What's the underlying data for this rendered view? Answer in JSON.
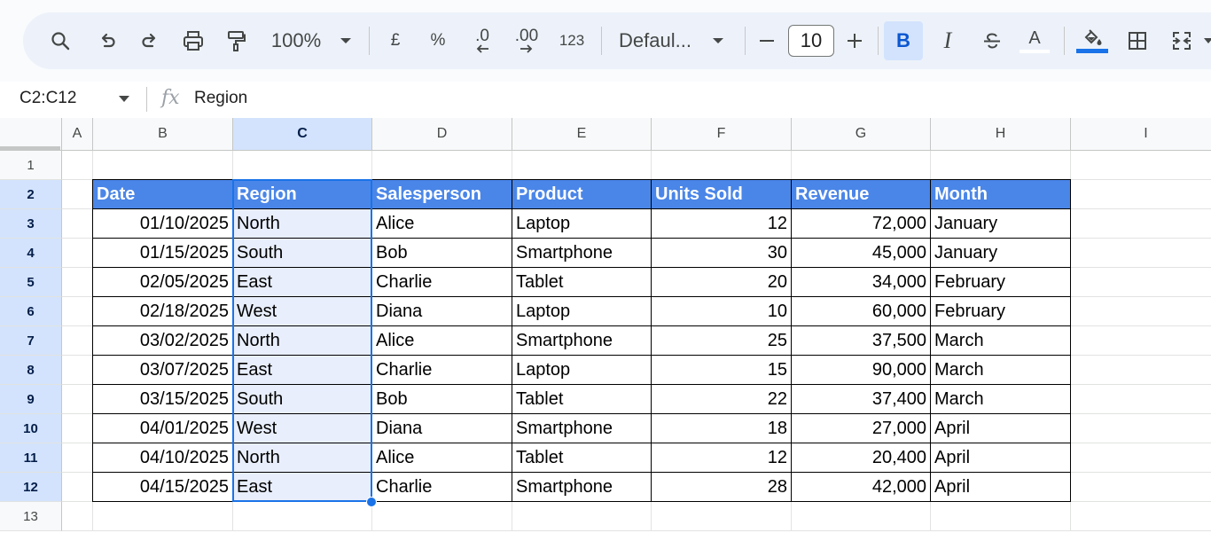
{
  "toolbar": {
    "zoom": "100%",
    "currency": "£",
    "percent": "%",
    "decrease_decimal": ".0",
    "increase_decimal": ".00",
    "number_format": "123",
    "font": "Defaul...",
    "font_size": "10",
    "bold": "B",
    "italic": "I",
    "text_color": "A",
    "text_color_bar": "#000000",
    "fill_color_bar": "#1a73e8"
  },
  "formula_bar": {
    "name_box": "C2:C12",
    "fx": "fx",
    "formula": "Region"
  },
  "columns": [
    "A",
    "B",
    "C",
    "D",
    "E",
    "F",
    "G",
    "H",
    "I"
  ],
  "rows": [
    "1",
    "2",
    "3",
    "4",
    "5",
    "6",
    "7",
    "8",
    "9",
    "10",
    "11",
    "12",
    "13"
  ],
  "table": {
    "headers": [
      "Date",
      "Region",
      "Salesperson",
      "Product",
      "Units Sold",
      "Revenue",
      "Month"
    ],
    "data": [
      [
        "01/10/2025",
        "North",
        "Alice",
        "Laptop",
        "12",
        "72,000",
        "January"
      ],
      [
        "01/15/2025",
        "South",
        "Bob",
        "Smartphone",
        "30",
        "45,000",
        "January"
      ],
      [
        "02/05/2025",
        "East",
        "Charlie",
        "Tablet",
        "20",
        "34,000",
        "February"
      ],
      [
        "02/18/2025",
        "West",
        "Diana",
        "Laptop",
        "10",
        "60,000",
        "February"
      ],
      [
        "03/02/2025",
        "North",
        "Alice",
        "Smartphone",
        "25",
        "37,500",
        "March"
      ],
      [
        "03/07/2025",
        "East",
        "Charlie",
        "Laptop",
        "15",
        "90,000",
        "March"
      ],
      [
        "03/15/2025",
        "South",
        "Bob",
        "Tablet",
        "22",
        "37,400",
        "March"
      ],
      [
        "04/01/2025",
        "West",
        "Diana",
        "Smartphone",
        "18",
        "27,000",
        "April"
      ],
      [
        "04/10/2025",
        "North",
        "Alice",
        "Tablet",
        "12",
        "20,400",
        "April"
      ],
      [
        "04/15/2025",
        "East",
        "Charlie",
        "Smartphone",
        "28",
        "42,000",
        "April"
      ]
    ]
  },
  "colors": {
    "header_fill": "#4a86e8",
    "selection": "#1a73e8",
    "selection_fill": "#e8eefb",
    "header_selected": "#d3e3fd"
  },
  "selected_column": "C",
  "selected_rows": [
    "2",
    "3",
    "4",
    "5",
    "6",
    "7",
    "8",
    "9",
    "10",
    "11",
    "12"
  ]
}
